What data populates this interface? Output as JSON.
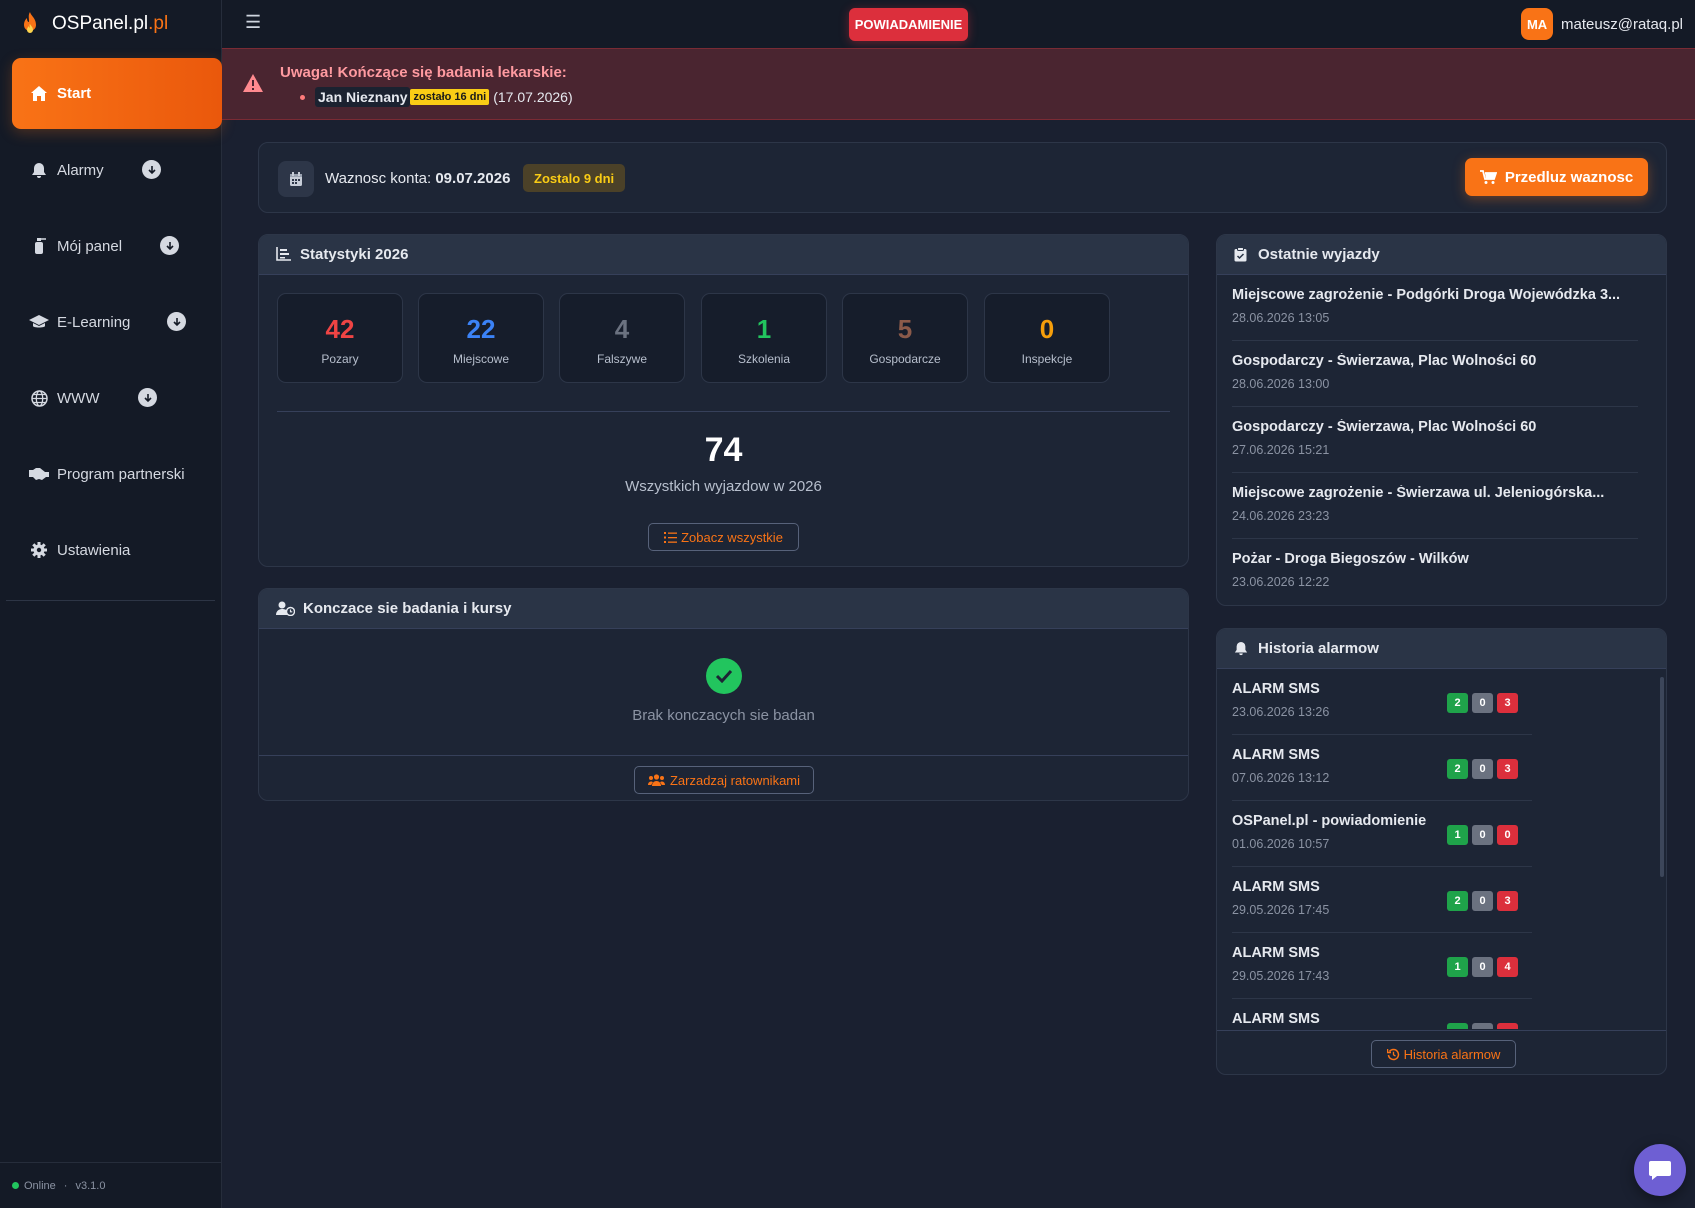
{
  "brand": {
    "name": "OSPanel.pl",
    "tld": ".pl"
  },
  "sidebar": {
    "items": [
      {
        "label": "Start",
        "icon": "home-icon",
        "active": true
      },
      {
        "label": "Alarmy",
        "icon": "bell-icon",
        "has_submenu": true
      },
      {
        "label": "Mój panel",
        "icon": "extinguisher-icon",
        "has_submenu": true
      },
      {
        "label": "E-Learning",
        "icon": "graduation-cap-icon",
        "has_submenu": true
      },
      {
        "label": "WWW",
        "icon": "globe-icon",
        "has_submenu": true
      },
      {
        "label": "Program partnerski",
        "icon": "handshake-icon"
      },
      {
        "label": "Ustawienia",
        "icon": "gear-icon"
      }
    ],
    "footer": {
      "status": "Online",
      "separator": "·",
      "version": "v3.1.0"
    }
  },
  "topbar": {
    "notify_label": "POWIADAMIENIE",
    "user": {
      "initials": "MA",
      "email": "mateusz@rataq.pl"
    }
  },
  "alert": {
    "title": "Uwaga! Kończące się badania lekarskie:",
    "items": [
      {
        "name": "Jan Nieznany",
        "badge": "zostało 16 dni",
        "date": "(17.07.2026)"
      }
    ]
  },
  "account": {
    "label": "Waznosc konta:",
    "date": "09.07.2026",
    "remaining": "Zostalo 9 dni",
    "extend_label": "Przedluz waznosc"
  },
  "stats": {
    "title": "Statystyki 2026",
    "items": [
      {
        "value": "42",
        "label": "Pozary",
        "color": "#ef4444"
      },
      {
        "value": "22",
        "label": "Miejscowe",
        "color": "#3b82f6"
      },
      {
        "value": "4",
        "label": "Falszywe",
        "color": "#6b7280"
      },
      {
        "value": "1",
        "label": "Szkolenia",
        "color": "#22c55e"
      },
      {
        "value": "5",
        "label": "Gospodarcze",
        "color": "#8b5a4a"
      },
      {
        "value": "0",
        "label": "Inspekcje",
        "color": "#f59e0b"
      }
    ],
    "total": "74",
    "total_label": "Wszystkich wyjazdow w 2026",
    "see_all": "Zobacz wszystkie"
  },
  "exams": {
    "title": "Konczace sie badania i kursy",
    "empty_message": "Brak konczacych sie badan",
    "manage": "Zarzadzaj ratownikami"
  },
  "trips": {
    "title": "Ostatnie wyjazdy",
    "items": [
      {
        "title": "Miejscowe zagrożenie - Podgórki Droga Wojewódzka 3...",
        "date": "28.06.2026 13:05"
      },
      {
        "title": "Gospodarczy - Świerzawa, Plac Wolności 60",
        "date": "28.06.2026 13:00"
      },
      {
        "title": "Gospodarczy - Świerzawa, Plac Wolności 60",
        "date": "27.06.2026 15:21"
      },
      {
        "title": "Miejscowe zagrożenie - Świerzawa ul. Jeleniogórska...",
        "date": "24.06.2026 23:23"
      },
      {
        "title": "Pożar - Droga Biegoszów - Wilków",
        "date": "23.06.2026 12:22"
      }
    ]
  },
  "history": {
    "title": "Historia alarmow",
    "items": [
      {
        "title": "ALARM SMS",
        "date": "23.06.2026 13:26",
        "yes": "2",
        "neutral": "0",
        "no": "3"
      },
      {
        "title": "ALARM SMS",
        "date": "07.06.2026 13:12",
        "yes": "2",
        "neutral": "0",
        "no": "3"
      },
      {
        "title": "OSPanel.pl - powiadomienie",
        "date": "01.06.2026 10:57",
        "yes": "1",
        "neutral": "0",
        "no": "0"
      },
      {
        "title": "ALARM SMS",
        "date": "29.05.2026 17:45",
        "yes": "2",
        "neutral": "0",
        "no": "3"
      },
      {
        "title": "ALARM SMS",
        "date": "29.05.2026 17:43",
        "yes": "1",
        "neutral": "0",
        "no": "4"
      },
      {
        "title": "ALARM SMS",
        "date": "",
        "yes": "",
        "neutral": "",
        "no": ""
      }
    ],
    "footer_button": "Historia alarmow"
  }
}
